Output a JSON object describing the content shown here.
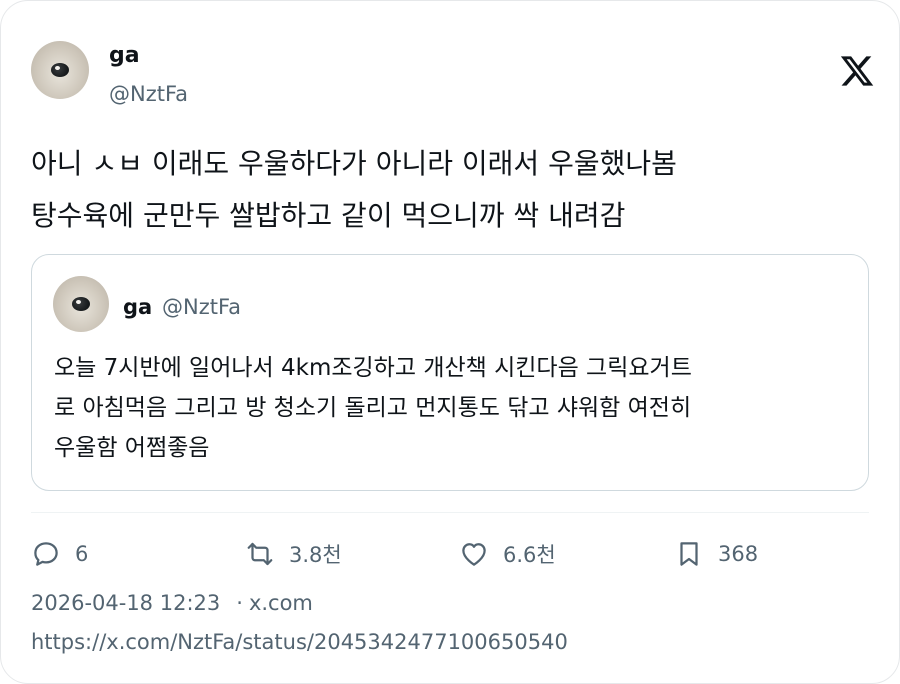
{
  "author": {
    "name": "ga",
    "handle": "@NztFa"
  },
  "tweet": {
    "lines": [
      "아니 ㅅㅂ 이래도 우울하다가 아니라 이래서 우울했나봄",
      "탕수육에 군만두 쌀밥하고 같이 먹으니까 싹 내려감"
    ]
  },
  "quote": {
    "name": "ga",
    "handle": "@NztFa",
    "lines": [
      "오늘 7시반에 일어나서 4km조깅하고 개산책 시킨다음 그릭요거트",
      "로 아침먹음 그리고 방 청소기 돌리고 먼지통도 닦고 샤워함 여전히",
      "우울함 어쩜좋음"
    ]
  },
  "actions": {
    "replies": "6",
    "retweets": "3.8천",
    "likes": "6.6천",
    "bookmarks": "368"
  },
  "meta": {
    "timestamp": "2026-04-18 12:23",
    "separator": "·",
    "source": "x.com"
  },
  "url": "https://x.com/NztFa/status/2045342477100650540",
  "icons": {
    "logo": "x-logo-icon",
    "reply": "reply-icon",
    "retweet": "retweet-icon",
    "like": "heart-icon",
    "bookmark": "bookmark-icon"
  },
  "colors": {
    "text": "#0f1419",
    "secondary": "#536471",
    "border": "#cfd9de"
  }
}
